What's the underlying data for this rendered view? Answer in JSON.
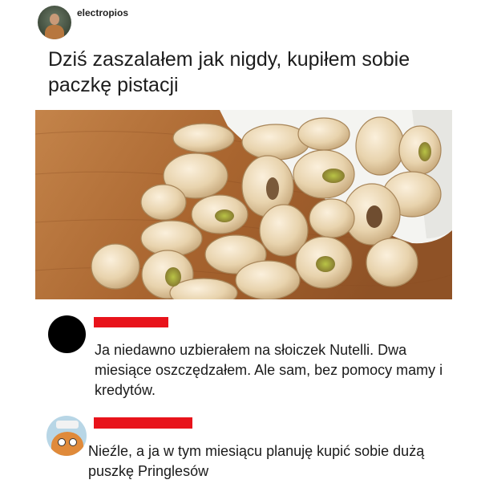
{
  "post": {
    "username": "electropios",
    "title": "Dziś zaszalałem jak nigdy, kupiłem sobie paczkę pistacji"
  },
  "comments": [
    {
      "text": "Ja niedawno uzbierałem na słoiczek Nutelli. Dwa miesiące oszczędzałem. Ale sam, bez pomocy mamy i kredytów."
    },
    {
      "text": "Nieźle, a ja w tym miesiącu planuję kupić sobie dużą puszkę Pringlesów"
    }
  ],
  "colors": {
    "redaction": "#e8131b",
    "text": "#1a1a1a",
    "background": "#ffffff"
  }
}
